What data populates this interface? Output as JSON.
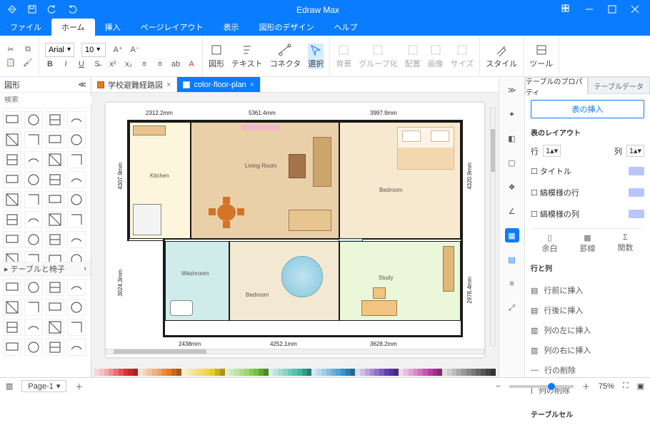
{
  "app_title": "Edraw Max",
  "menu_tabs": [
    "ファイル",
    "ホーム",
    "挿入",
    "ページレイアウト",
    "表示",
    "図形のデザイン",
    "ヘルプ"
  ],
  "active_menu_tab": 1,
  "ribbon": {
    "font_name": "Arial",
    "font_size": "10",
    "tool_labels": [
      "図形",
      "テキスト",
      "コネクタ",
      "選択"
    ],
    "group_labels": [
      "背景",
      "グループ化",
      "配置",
      "画像",
      "サイズ"
    ],
    "style": "スタイル",
    "tool": "ツール"
  },
  "left_panel": {
    "title": "図形",
    "search_placeholder": "検索",
    "category": "テーブルと椅子"
  },
  "doc_tabs": [
    {
      "icon_color": "#e67a17",
      "label": "学校避難経路図",
      "active": false
    },
    {
      "icon_color": "#ffffff",
      "label": "color-floor-plan",
      "active": true
    }
  ],
  "floorplan": {
    "dims_top": [
      "2312.2mm",
      "5361.4mm",
      "3997.9mm"
    ],
    "dims_bottom": [
      "2438mm",
      "4252.1mm",
      "3628.2mm"
    ],
    "dim_left_upper": "4307.9mm",
    "dim_left_lower": "3024.3mm",
    "dim_right_upper": "4320.9mm",
    "dim_right_lower": "2978.4mm",
    "rooms": {
      "kitchen": "Kitchen",
      "living": "Living Room",
      "bedroom1": "Bedroom",
      "washroom": "Washroom",
      "bedroom2": "Bedroom",
      "study": "Study"
    }
  },
  "right_panel": {
    "tabs": [
      "テーブルのプロパティ",
      "テーブルデータ"
    ],
    "insert_btn": "表の挿入",
    "layout_title": "表のレイアウト",
    "row_label": "行",
    "row_val": "1",
    "col_label": "列",
    "col_val": "1",
    "checks": [
      "タイトル",
      "縞模様の行",
      "縞模様の列"
    ],
    "split_labels": [
      "余白",
      "罫線",
      "関数"
    ],
    "rowcol_title": "行と列",
    "ops": [
      "行前に挿入",
      "行後に挿入",
      "列の左に挿入",
      "列の右に挿入",
      "行の削除",
      "列の削除"
    ],
    "cell_title": "テーブルセル"
  },
  "status": {
    "page": "Page-1",
    "zoom": "75%"
  },
  "palette": [
    "#f4d6d6",
    "#f2c2c2",
    "#efabab",
    "#ec8f8f",
    "#e96f6f",
    "#e55252",
    "#e03232",
    "#c72a2a",
    "#a82323",
    "#f6e3d2",
    "#f4d3b7",
    "#f2c29a",
    "#efb17d",
    "#eda060",
    "#ea8d3f",
    "#e77b22",
    "#c9691c",
    "#a95717",
    "#f7f1d1",
    "#f5ebb6",
    "#f3e59a",
    "#f1df7e",
    "#efd962",
    "#edd446",
    "#eacd25",
    "#ccb21e",
    "#ad9618",
    "#e0f0d4",
    "#ceeabb",
    "#bce3a2",
    "#aadc88",
    "#98d66e",
    "#85cf54",
    "#71c638",
    "#5fa82f",
    "#4e8a26",
    "#d4eeea",
    "#bce5de",
    "#a3dcd2",
    "#8ad3c6",
    "#71cabb",
    "#59c1af",
    "#3db7a2",
    "#349b89",
    "#2a7e70",
    "#d3e8f6",
    "#b9daf0",
    "#9fcce9",
    "#85bee3",
    "#6bb0dd",
    "#50a2d6",
    "#3492ce",
    "#2c7cb0",
    "#246691",
    "#e0d8f1",
    "#ccbfe7",
    "#b8a5dc",
    "#a48cd2",
    "#9072c7",
    "#7c59bd",
    "#663eb1",
    "#563496",
    "#462b7b",
    "#f1d6ea",
    "#e8bdde",
    "#dfa4d3",
    "#d68bc7",
    "#cd72bc",
    "#c458b0",
    "#b93da3",
    "#9d338a",
    "#812a71",
    "#ddd",
    "#ccc",
    "#bbb",
    "#aaa",
    "#999",
    "#888",
    "#777",
    "#666",
    "#555",
    "#444",
    "#333"
  ]
}
